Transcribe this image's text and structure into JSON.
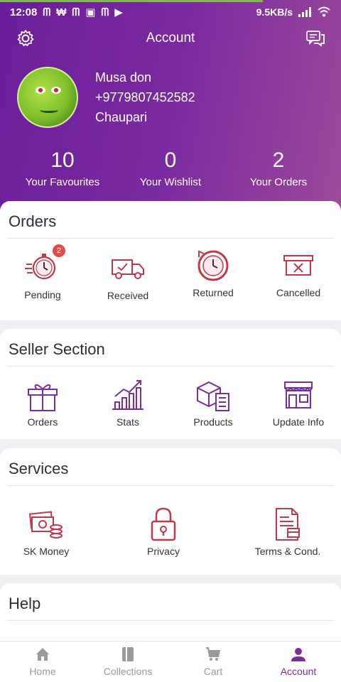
{
  "status": {
    "time": "12:08",
    "network_speed": "9.5KB/s",
    "notif_icons": [
      "m-icon",
      "w-icon",
      "m-icon",
      "gallery-icon",
      "m-icon",
      "play-icon"
    ]
  },
  "topbar": {
    "title": "Account"
  },
  "profile": {
    "name": "Musa don",
    "phone": "+9779807452582",
    "location": "Chaupari"
  },
  "stats": [
    {
      "value": "10",
      "label": "Your Favourites"
    },
    {
      "value": "0",
      "label": "Your Wishlist"
    },
    {
      "value": "2",
      "label": "Your Orders"
    }
  ],
  "orders": {
    "title": "Orders",
    "items": [
      {
        "label": "Pending",
        "badge": "2"
      },
      {
        "label": "Received"
      },
      {
        "label": "Returned"
      },
      {
        "label": "Cancelled"
      }
    ]
  },
  "seller": {
    "title": "Seller Section",
    "items": [
      {
        "label": "Orders"
      },
      {
        "label": "Stats"
      },
      {
        "label": "Products"
      },
      {
        "label": "Update Info"
      }
    ]
  },
  "services": {
    "title": "Services",
    "items": [
      {
        "label": "SK Money"
      },
      {
        "label": "Privacy"
      },
      {
        "label": "Terms & Cond."
      }
    ]
  },
  "help": {
    "title": "Help"
  },
  "nav": [
    {
      "label": "Home"
    },
    {
      "label": "Collections"
    },
    {
      "label": "Cart"
    },
    {
      "label": "Account"
    }
  ],
  "colors": {
    "accent": "#7b2d9b",
    "icon": "#c0394b",
    "header_start": "#6b1e9a",
    "header_end": "#9c4a9a"
  }
}
